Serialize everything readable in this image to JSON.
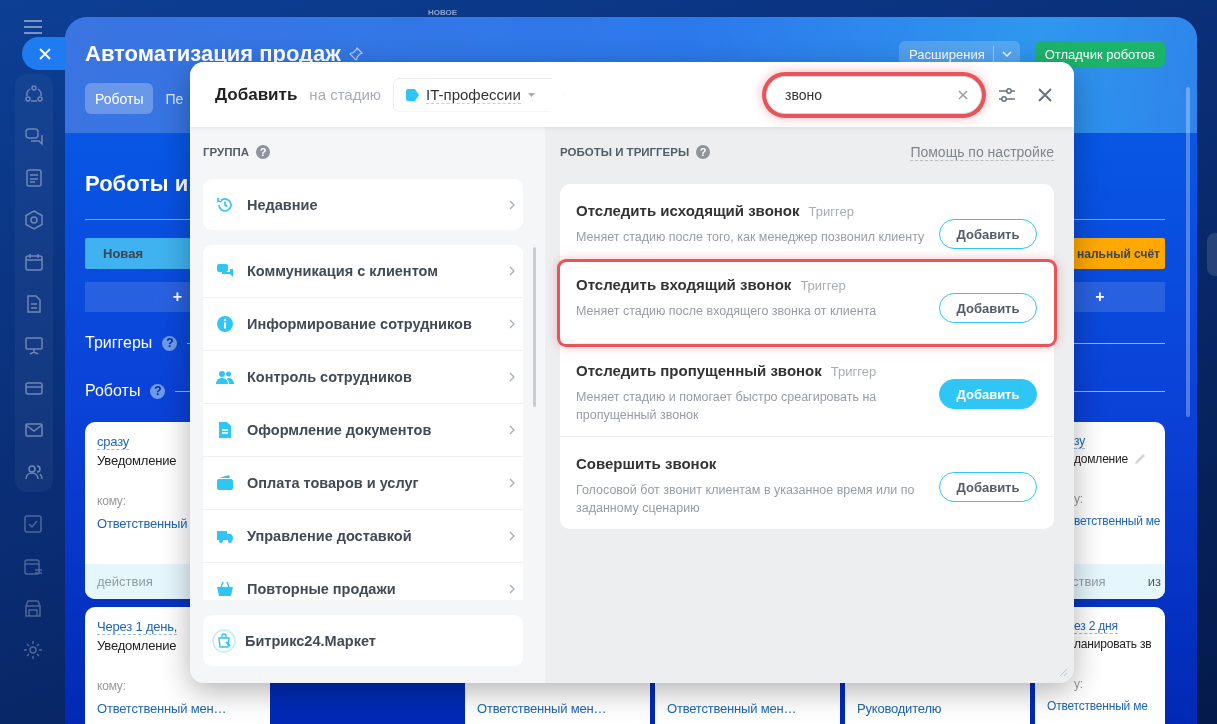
{
  "background": {
    "badge": "НОВОЕ",
    "title": "Автоматизация продаж",
    "tabs": [
      {
        "label": "Роботы",
        "selected": true
      },
      {
        "label": "Пе",
        "selected": false
      }
    ],
    "extensions_button": "Расширения",
    "debugger_button": "Отладчик роботов",
    "heading": "Роботы и",
    "triggers_label": "Триггеры",
    "robots_label": "Роботы",
    "help_mark": "?",
    "columns": [
      {
        "stage": {
          "label": "Новая",
          "color": "#3fb2ef",
          "add": "+"
        },
        "cards": [
          {
            "delay": "сразу",
            "title": "Уведомление",
            "to_label": "кому:",
            "recipient": "Ответственный",
            "actions_label": "действия"
          },
          {
            "delay": "Через 1 день,",
            "title": "Уведомление",
            "to_label": "кому:",
            "recipient": "Ответственный мен…"
          }
        ]
      },
      {},
      {
        "cards": [
          {
            "recipient": "Ответственный мен…"
          }
        ]
      },
      {
        "cards": [
          {
            "recipient": "Ответственный мен…"
          }
        ]
      },
      {
        "cards": [
          {
            "recipient": "Руководителю"
          }
        ]
      },
      {
        "stage": {
          "label": "нальный счёт",
          "color": "#ffa900",
          "add": "+"
        },
        "cards": [
          {
            "delay": "зу",
            "title": "домление",
            "editable": true,
            "to_label": "у:",
            "recipient": "ветственный ме",
            "actions_label": "ствия",
            "extra_label": "из"
          },
          {
            "delay": "ез 2 дня",
            "title": "ланировать зв",
            "to_label": "у:",
            "recipient": "Ответственный ме"
          }
        ]
      }
    ]
  },
  "dialog": {
    "title": "Добавить",
    "stage_prefix": "на стадию",
    "stage": {
      "label": "IT-профессии",
      "color": "#2fc6f6"
    },
    "search": {
      "value": "звоно",
      "highlighted": true
    },
    "groups_panel": {
      "title": "ГРУППА",
      "help_mark": "?",
      "recent": "Недавние",
      "groups": [
        "Коммуникация с клиентом",
        "Информирование сотрудников",
        "Контроль сотрудников",
        "Оформление документов",
        "Оплата товаров и услуг",
        "Управление доставкой",
        "Повторные продажи"
      ],
      "market": "Битрикс24.Маркет"
    },
    "results_panel": {
      "title": "РОБОТЫ И ТРИГГЕРЫ",
      "help_mark": "?",
      "help_link": "Помощь по настройке",
      "items": [
        {
          "title": "Отследить исходящий звонок",
          "tag": "Триггер",
          "description": "Меняет стадию после того, как менеджер позвонил клиенту",
          "button": "Добавить",
          "highlighted": false,
          "hovered": false
        },
        {
          "title": "Отследить входящий звонок",
          "tag": "Триггер",
          "description": "Меняет стадию после входящего звонка от клиента",
          "button": "Добавить",
          "highlighted": true,
          "hovered": false
        },
        {
          "title": "Отследить пропущенный звонок",
          "tag": "Триггер",
          "description": "Меняет стадию и помогает быстро среагировать на пропущенный звонок",
          "button": "Добавить",
          "highlighted": false,
          "hovered": true
        },
        {
          "title": "Совершить звонок",
          "description": "Голосовой бот звонит клиентам в указанное время или по заданному сценарию",
          "button": "Добавить",
          "highlighted": false,
          "hovered": false
        }
      ]
    }
  }
}
